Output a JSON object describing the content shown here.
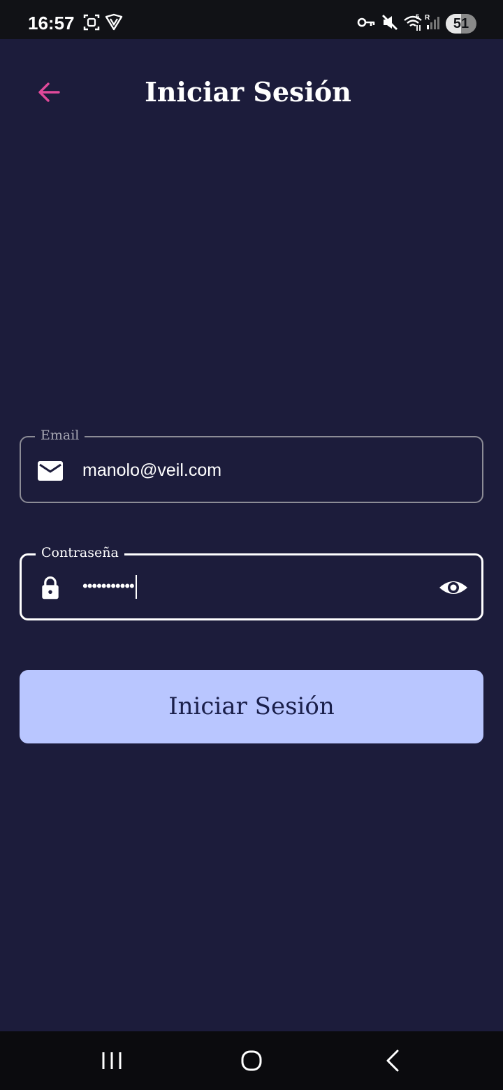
{
  "status_bar": {
    "time": "16:57",
    "battery_level": "51",
    "battery_fraction": 0.51,
    "icons": [
      "screenshot-icon",
      "vpn-shield-icon",
      "key-icon",
      "mute-icon",
      "wifi-icon",
      "signal-icon",
      "battery-icon"
    ]
  },
  "header": {
    "title": "Iniciar Sesión",
    "back_icon": "arrow-left-icon"
  },
  "form": {
    "email": {
      "label": "Email",
      "value": "manolo@veil.com",
      "icon": "mail-icon"
    },
    "password": {
      "label": "Contraseña",
      "masked_value": "•••••••••••",
      "icon": "lock-icon",
      "toggle_icon": "eye-icon"
    },
    "submit_label": "Iniciar Sesión"
  },
  "nav_bar": {
    "icons": [
      "recents-icon",
      "home-icon",
      "back-icon"
    ]
  },
  "colors": {
    "background": "#1c1c3b",
    "accent": "#e0499a",
    "button": "#b9c6ff",
    "button_text": "#1a1f4a"
  }
}
